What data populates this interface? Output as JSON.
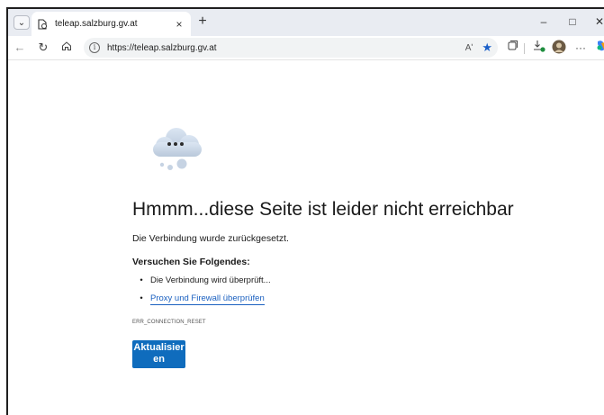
{
  "browser": {
    "tab_title": "teleap.salzburg.gv.at",
    "tab_close": "×",
    "new_tab": "+",
    "url": "https://teleap.salzburg.gv.at",
    "read_aloud": "Aʹ",
    "window_controls": {
      "minimize": "–",
      "maximize": "□",
      "close": "✕"
    }
  },
  "error_page": {
    "headline": "Hmmm...diese Seite ist leider nicht erreichbar",
    "subtitle": "Die Verbindung wurde zurückgesetzt.",
    "try_heading": "Versuchen Sie Folgendes:",
    "suggestions": [
      {
        "text": "Die Verbindung wird überprüft...",
        "link": false
      },
      {
        "text": "Proxy und Firewall überprüfen",
        "link": true
      }
    ],
    "error_code": "ERR_CONNECTION_RESET",
    "reload_button": "Aktualisieren"
  },
  "colors": {
    "accent": "#0f6cbd",
    "link": "#1a60c0",
    "tab_strip": "#e9ecf2"
  },
  "icons": [
    "tab-actions-icon",
    "page-favicon-icon",
    "back-icon",
    "refresh-icon",
    "home-icon",
    "info-icon",
    "favorites-star-icon",
    "collections-icon",
    "downloads-icon",
    "profile-avatar-icon",
    "more-icon",
    "copilot-icon",
    "cloud-icon"
  ]
}
